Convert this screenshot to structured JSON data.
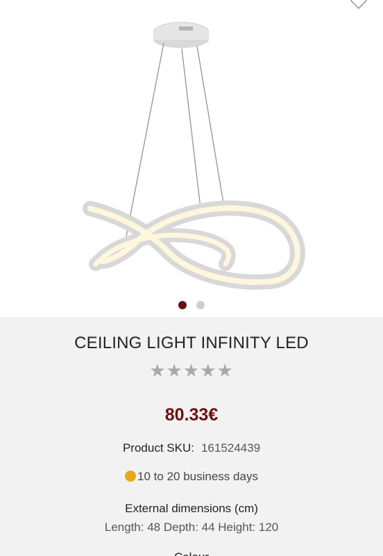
{
  "product": {
    "title": "CEILING LIGHT INFINITY LED",
    "rating_stars": "★★★★★",
    "rating_value": 0,
    "price": "80.33€",
    "sku_label": "Product SKU:",
    "sku_value": "161524439",
    "delivery_text": "10 to 20 business days",
    "dimensions_title": "External dimensions (cm)",
    "dimensions_values": "Length: 48 Depth: 44 Height: 120",
    "next_section_partial": "Colour"
  },
  "gallery": {
    "image_count": 2,
    "active_index": 0
  },
  "icons": {
    "favorite": "heart-outline-icon",
    "delivery_status": "status-dot-icon"
  },
  "colors": {
    "accent": "#6b0f12",
    "delivery_status": "#e8a81c",
    "star_inactive": "#a9a9a9"
  }
}
